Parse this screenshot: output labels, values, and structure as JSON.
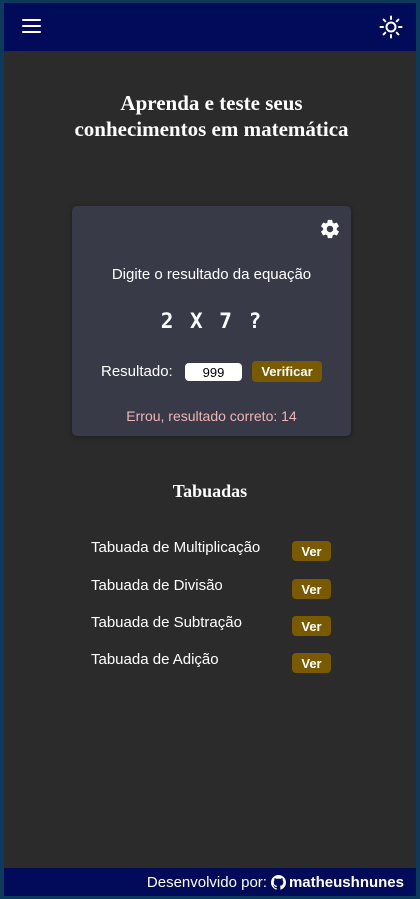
{
  "header": {
    "menu_icon": "hamburger-menu-icon",
    "theme_icon": "sun-icon",
    "background": "#020a5a"
  },
  "main": {
    "title": "Aprenda e teste seus conhecimentos em matemática"
  },
  "quiz": {
    "settings_icon": "gear-icon",
    "instruction": "Digite o resultado da equação",
    "equation": "2 X 7 ?",
    "result_label": "Resultado:",
    "result_value": "999",
    "verify_label": "Verificar",
    "feedback": "Errou, resultado correto: 14",
    "card_color": "#383a48",
    "button_color": "#7a5a00",
    "feedback_color": "#f0b4b4"
  },
  "tabuadas": {
    "heading": "Tabuadas",
    "items": [
      {
        "label": "Tabuada de Multiplicação",
        "button": "Ver"
      },
      {
        "label": "Tabuada de Divisão",
        "button": "Ver"
      },
      {
        "label": "Tabuada de Subtração",
        "button": "Ver"
      },
      {
        "label": "Tabuada de Adição",
        "button": "Ver"
      }
    ]
  },
  "footer": {
    "prefix": "Desenvolvido por:",
    "icon": "github-icon",
    "username": "matheushnunes"
  }
}
